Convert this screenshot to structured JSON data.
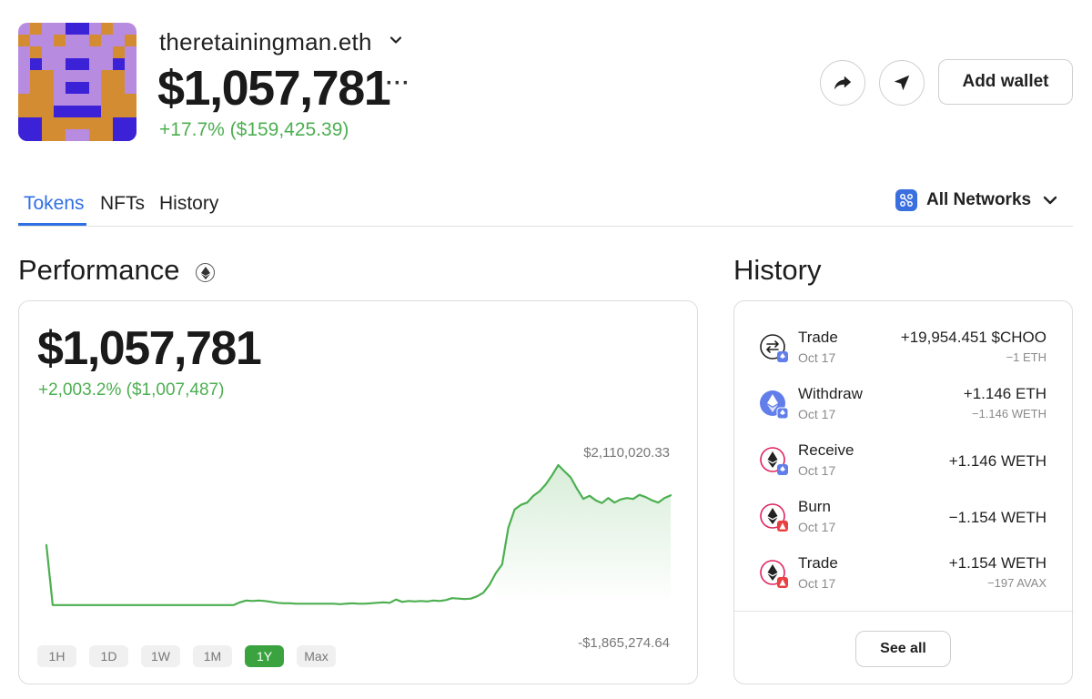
{
  "wallet": {
    "name": "theretainingman.eth",
    "balance": "$1,057,781",
    "change": "+17.7% ($159,425.39)",
    "more_icon": "more-horizontal-icon",
    "avatar_icon": "pixel-art-nft-avatar"
  },
  "actions": {
    "share_icon": "share-arrow-icon",
    "send_icon": "send-arrow-icon",
    "add_wallet_label": "Add wallet"
  },
  "tabs": [
    {
      "label": "Tokens",
      "active": true
    },
    {
      "label": "NFTs",
      "active": false
    },
    {
      "label": "History",
      "active": false
    }
  ],
  "networks": {
    "label": "All Networks",
    "icon": "networks-grid-icon"
  },
  "performance": {
    "title": "Performance",
    "value": "$1,057,781",
    "change": "+2,003.2% ($1,007,487)",
    "max_label": "$2,110,020.33",
    "min_label": "-$1,865,274.64",
    "ranges": [
      {
        "label": "1H",
        "active": false
      },
      {
        "label": "1D",
        "active": false
      },
      {
        "label": "1W",
        "active": false
      },
      {
        "label": "1M",
        "active": false
      },
      {
        "label": "1Y",
        "active": true
      },
      {
        "label": "Max",
        "active": false
      }
    ]
  },
  "chart_data": {
    "type": "line",
    "title": "",
    "xlabel": "",
    "ylabel": "",
    "x": [
      0,
      1,
      2,
      3,
      4,
      5,
      6,
      7,
      8,
      9,
      10,
      11,
      12,
      13,
      14,
      15,
      16,
      17,
      18,
      19,
      20,
      21,
      22,
      23,
      24,
      25,
      26,
      27,
      28,
      29,
      30,
      31,
      32,
      33,
      34,
      35,
      36,
      37,
      38,
      39,
      40,
      41,
      42,
      43,
      44,
      45,
      46,
      47,
      48,
      49,
      50,
      51,
      52,
      53,
      54,
      55,
      56,
      57,
      58,
      59,
      60,
      61,
      62,
      63,
      64,
      65,
      66,
      67,
      68,
      69,
      70,
      71,
      72,
      73,
      74,
      75,
      76,
      77,
      78,
      79,
      80,
      81,
      82,
      83,
      84,
      85,
      86,
      87,
      88,
      89,
      90,
      91,
      92,
      93,
      94,
      95,
      96,
      97,
      98,
      99,
      100
    ],
    "series": [
      {
        "values": [
          0.32,
          -0.99,
          -0.99,
          -0.99,
          -0.99,
          -0.99,
          -0.99,
          -0.99,
          -0.99,
          -0.99,
          -0.99,
          -0.99,
          -0.99,
          -0.99,
          -0.99,
          -0.99,
          -0.99,
          -0.99,
          -0.99,
          -0.99,
          -0.99,
          -0.99,
          -0.99,
          -0.99,
          -0.99,
          -0.99,
          -0.99,
          -0.99,
          -0.99,
          -0.99,
          -0.99,
          -0.93,
          -0.89,
          -0.9,
          -0.89,
          -0.9,
          -0.92,
          -0.94,
          -0.95,
          -0.95,
          -0.96,
          -0.96,
          -0.96,
          -0.96,
          -0.96,
          -0.96,
          -0.96,
          -0.97,
          -0.96,
          -0.95,
          -0.96,
          -0.96,
          -0.95,
          -0.94,
          -0.93,
          -0.94,
          -0.87,
          -0.92,
          -0.9,
          -0.91,
          -0.9,
          -0.91,
          -0.89,
          -0.9,
          -0.88,
          -0.84,
          -0.85,
          -0.86,
          -0.85,
          -0.8,
          -0.72,
          -0.54,
          -0.29,
          -0.1,
          0.7,
          1.1,
          1.2,
          1.25,
          1.4,
          1.5,
          1.65,
          1.85,
          2.07,
          1.93,
          1.8,
          1.55,
          1.33,
          1.4,
          1.3,
          1.24,
          1.35,
          1.25,
          1.32,
          1.35,
          1.33,
          1.42,
          1.37,
          1.3,
          1.25,
          1.35,
          1.41
        ]
      }
    ],
    "ylim": [
      -1.87,
      2.11
    ],
    "grid": false,
    "color": "#4caf50",
    "fill": "gradient-green"
  },
  "history": {
    "title": "History",
    "see_all_label": "See all",
    "items": [
      {
        "type": "Trade",
        "date": "Oct 17",
        "amount": "+19,954.451 $CHOO",
        "sub": "−1 ETH",
        "icon": "trade-swap-icon",
        "badge": "ethereum-badge-icon"
      },
      {
        "type": "Withdraw",
        "date": "Oct 17",
        "amount": "+1.146 ETH",
        "sub": "−1.146 WETH",
        "icon": "ethereum-withdraw-icon",
        "badge": "ethereum-badge-icon"
      },
      {
        "type": "Receive",
        "date": "Oct 17",
        "amount": "+1.146 WETH",
        "sub": "",
        "icon": "weth-receive-icon",
        "badge": "ethereum-badge-icon"
      },
      {
        "type": "Burn",
        "date": "Oct 17",
        "amount": "−1.154 WETH",
        "sub": "",
        "icon": "weth-burn-icon",
        "badge": "avalanche-badge-icon"
      },
      {
        "type": "Trade",
        "date": "Oct 17",
        "amount": "+1.154 WETH",
        "sub": "−197 AVAX",
        "icon": "weth-trade-icon",
        "badge": "avalanche-badge-icon"
      }
    ]
  },
  "colors": {
    "accent_blue": "#2f6fe3",
    "positive_green": "#4caf50",
    "active_range_green": "#3aa33f",
    "avatar_purple": "#b78be0",
    "avatar_orange": "#d48c32",
    "avatar_blue": "#3b22d6",
    "avalanche_red": "#e84142"
  }
}
